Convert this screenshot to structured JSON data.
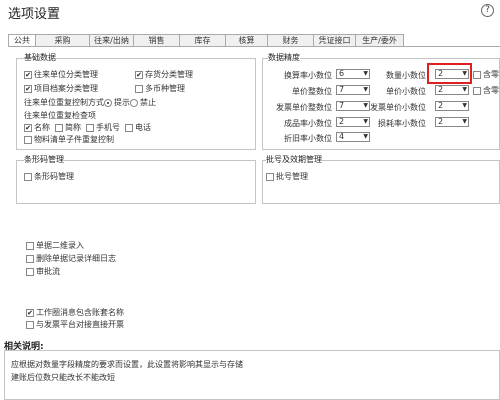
{
  "window": {
    "title": "选项设置",
    "help_icon": "?"
  },
  "tabs": [
    "公共",
    "采购",
    "往来/出纳",
    "销售",
    "库存",
    "核算",
    "财务",
    "凭证接口",
    "生产/委外"
  ],
  "basic": {
    "title": "基础数据",
    "options": [
      {
        "label": "往来单位分类管理",
        "checked": true
      },
      {
        "label": "存货分类管理",
        "checked": true
      },
      {
        "label": "项目档案分类管理",
        "checked": true
      },
      {
        "label": "多币种管理",
        "checked": false
      }
    ],
    "dup_mode_label": "往来单位重复控制方式",
    "dup_mode_options": [
      {
        "label": "提示",
        "selected": true
      },
      {
        "label": "禁止",
        "selected": false
      }
    ],
    "dup_check_label": "往来单位重复检查项",
    "dup_check_options": [
      {
        "label": "名称",
        "checked": true
      },
      {
        "label": "简称",
        "checked": false
      },
      {
        "label": "手机号",
        "checked": false
      },
      {
        "label": "电话",
        "checked": false
      }
    ],
    "material_option": {
      "label": "物料清单子件重复控制",
      "checked": false
    }
  },
  "precision": {
    "title": "数据精度",
    "left": [
      {
        "label": "换算率小数位",
        "value": "6"
      },
      {
        "label": "单价整数位",
        "value": "7"
      },
      {
        "label": "发票单价整数位",
        "value": "7"
      },
      {
        "label": "成品率小数位",
        "value": "2"
      },
      {
        "label": "折旧率小数位",
        "value": "4"
      }
    ],
    "right": [
      {
        "label": "数量小数位",
        "value": "2"
      },
      {
        "label": "单价小数位",
        "value": "2"
      },
      {
        "label": "发票单价小数位",
        "value": "2"
      },
      {
        "label": "损耗率小数位",
        "value": "2"
      }
    ],
    "side": [
      "含零",
      "含零"
    ]
  },
  "barcode": {
    "title": "条形码管理",
    "option": {
      "label": "条形码管理",
      "checked": false
    }
  },
  "batch": {
    "title": "批号及效期管理",
    "option": {
      "label": "批号管理",
      "checked": false
    }
  },
  "misc": [
    {
      "label": "单据二维录入",
      "checked": false
    },
    {
      "label": "删除单据记录详细日志",
      "checked": false
    },
    {
      "label": "审批流",
      "checked": false
    }
  ],
  "misc2": [
    {
      "label": "工作圈消息包含账套名称",
      "checked": true
    },
    {
      "label": "与发票平台对接直接开票",
      "checked": false
    }
  ],
  "description": {
    "title": "相关说明:",
    "lines": [
      "应根据对数量字段精度的要求而设置，此设置将影响其显示与存储",
      "建账后位数只能改长不能改短"
    ]
  },
  "marks": {
    "check": "✔",
    "arrow": "▼"
  }
}
